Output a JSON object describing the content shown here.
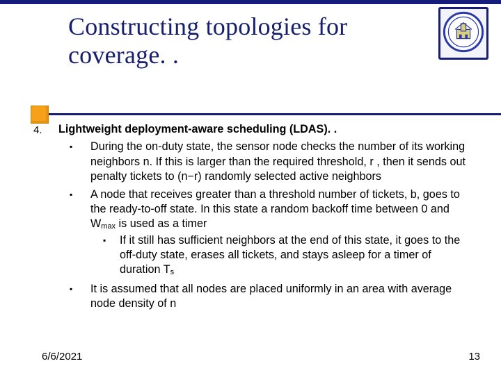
{
  "title": "Constructing topologies for coverage. .",
  "list_number": "4.",
  "heading": "Lightweight deployment-aware scheduling (LDAS). .",
  "bullets": [
    {
      "html": "During the on-duty state, the sensor node checks the number of its working neighbors n. If this is larger than the required threshold, r , then it sends out penalty tickets to (n−r) randomly selected active neighbors"
    },
    {
      "html": "A node that receives greater than a threshold number of tickets, b, goes to the ready-to-off state. In this state a random backoff time between 0 and W<sub>max</sub> is used as a timer",
      "sub": [
        {
          "html": "If it still has sufficient neighbors at the end of this state, it goes to the off-duty state, erases all tickets, and stays asleep for a timer of duration T<sub>s</sub>"
        }
      ]
    },
    {
      "html": "It is assumed that all nodes are placed uniformly in an area with average node density of n"
    }
  ],
  "footer": {
    "date": "6/6/2021",
    "page": "13"
  },
  "logo_name": "university-seal-icon"
}
